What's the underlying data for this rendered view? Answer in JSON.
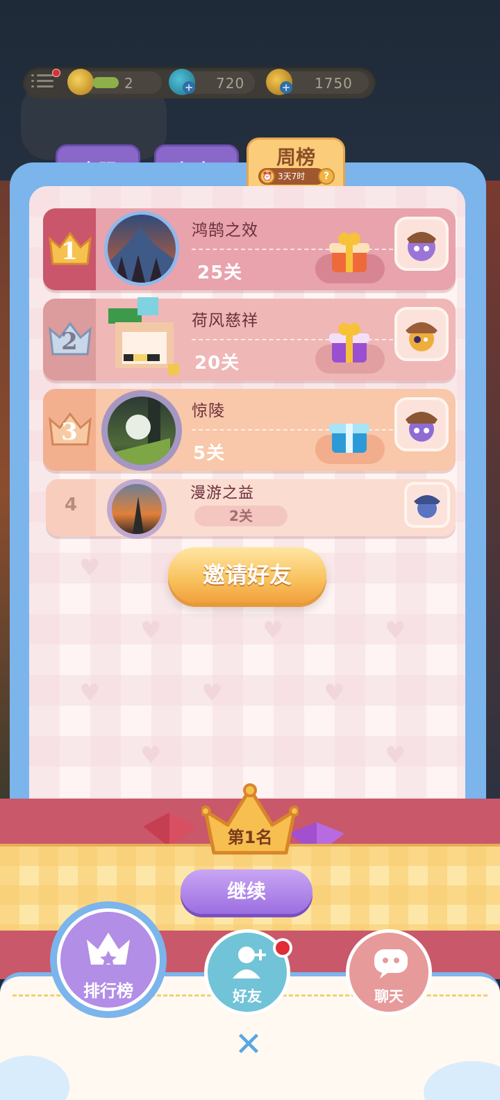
{
  "currencies": [
    {
      "name": "level-tickets",
      "value": "2"
    },
    {
      "name": "gems",
      "value": "720"
    },
    {
      "name": "coins",
      "value": "1750"
    }
  ],
  "tabs": [
    {
      "label": "全服",
      "active": false
    },
    {
      "label": "好友",
      "active": false
    },
    {
      "label": "周榜",
      "active": true
    }
  ],
  "weekly_timer": "3天7时",
  "help_glyph": "?",
  "leaderboard": [
    {
      "rank": "1",
      "name": "鸿鹄之效",
      "levels": "25关",
      "gift": "orange-gift"
    },
    {
      "rank": "2",
      "name": "荷风慈祥",
      "levels": "20关",
      "gift": "purple-gift"
    },
    {
      "rank": "3",
      "name": "惊陵",
      "levels": "5关",
      "gift": "blue-gift"
    },
    {
      "rank": "4",
      "name": "漫游之益",
      "levels": "2关",
      "gift": ""
    }
  ],
  "invite_label": "邀请好友",
  "result_rank": "第1名",
  "continue_label": "继续",
  "nav": [
    {
      "label": "排行榜",
      "icon": "crown-icon"
    },
    {
      "label": "好友",
      "icon": "add-friend-icon",
      "badge": true
    },
    {
      "label": "聊天",
      "icon": "chat-icon"
    }
  ],
  "close_glyph": "✕",
  "colors": {
    "tab_purple": "#8a68c9",
    "tab_active": "#fbcd7a",
    "frame_blue": "#7cb4ec",
    "row1": "#e8a3ad",
    "row2": "#efb7b6",
    "row3": "#f9c7a9",
    "row4": "#fbdcd0",
    "invite_orange": "#f8c15c",
    "continue_purple": "#9b6ee0"
  }
}
